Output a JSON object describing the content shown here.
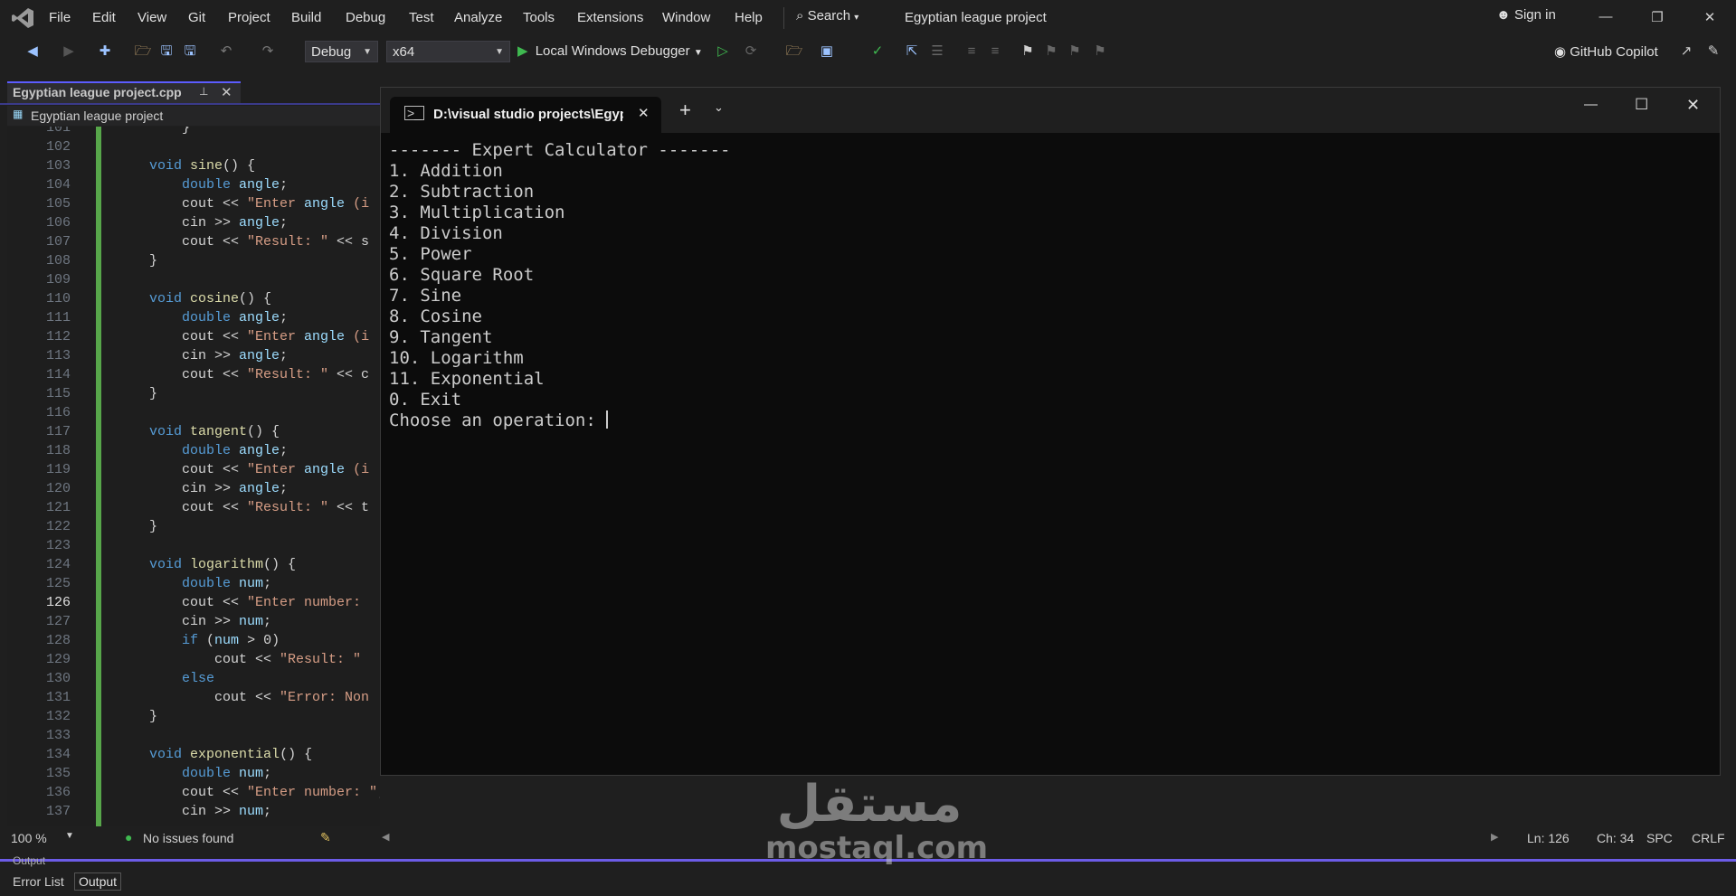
{
  "menu": {
    "items": [
      "File",
      "Edit",
      "View",
      "Git",
      "Project",
      "Build",
      "Debug",
      "Test",
      "Analyze",
      "Tools",
      "Extensions",
      "Window",
      "Help"
    ],
    "search_label": "Search",
    "solution_title": "Egyptian league project",
    "sign_in": "Sign in"
  },
  "toolbar": {
    "configuration": "Debug",
    "platform": "x64",
    "debugger_label": "Local Windows Debugger",
    "copilot_label": "GitHub Copilot"
  },
  "editor": {
    "tab_label": "Egyptian league project.cpp",
    "nav_project": "Egyptian league project",
    "lines": [
      {
        "num": "101",
        "text": "    }"
      },
      {
        "num": "102",
        "text": ""
      },
      {
        "num": "103",
        "text": "void sine() {"
      },
      {
        "num": "104",
        "text": "    double angle;"
      },
      {
        "num": "105",
        "text": "    cout << \"Enter angle (i"
      },
      {
        "num": "106",
        "text": "    cin >> angle;"
      },
      {
        "num": "107",
        "text": "    cout << \"Result: \" << s"
      },
      {
        "num": "108",
        "text": "}"
      },
      {
        "num": "109",
        "text": ""
      },
      {
        "num": "110",
        "text": "void cosine() {"
      },
      {
        "num": "111",
        "text": "    double angle;"
      },
      {
        "num": "112",
        "text": "    cout << \"Enter angle (i"
      },
      {
        "num": "113",
        "text": "    cin >> angle;"
      },
      {
        "num": "114",
        "text": "    cout << \"Result: \" << c"
      },
      {
        "num": "115",
        "text": "}"
      },
      {
        "num": "116",
        "text": ""
      },
      {
        "num": "117",
        "text": "void tangent() {"
      },
      {
        "num": "118",
        "text": "    double angle;"
      },
      {
        "num": "119",
        "text": "    cout << \"Enter angle (i"
      },
      {
        "num": "120",
        "text": "    cin >> angle;"
      },
      {
        "num": "121",
        "text": "    cout << \"Result: \" << t"
      },
      {
        "num": "122",
        "text": "}"
      },
      {
        "num": "123",
        "text": ""
      },
      {
        "num": "124",
        "text": "void logarithm() {"
      },
      {
        "num": "125",
        "text": "    double num;"
      },
      {
        "num": "126",
        "text": "    cout << \"Enter number: "
      },
      {
        "num": "127",
        "text": "    cin >> num;"
      },
      {
        "num": "128",
        "text": "    if (num > 0)"
      },
      {
        "num": "129",
        "text": "        cout << \"Result: \""
      },
      {
        "num": "130",
        "text": "    else"
      },
      {
        "num": "131",
        "text": "        cout << \"Error: Non"
      },
      {
        "num": "132",
        "text": "}"
      },
      {
        "num": "133",
        "text": ""
      },
      {
        "num": "134",
        "text": "void exponential() {"
      },
      {
        "num": "135",
        "text": "    double num;"
      },
      {
        "num": "136",
        "text": "    cout << \"Enter number: \";"
      },
      {
        "num": "137",
        "text": "    cin >> num;"
      }
    ]
  },
  "console": {
    "tab_title": "D:\\visual studio projects\\Egyp",
    "output": "------- Expert Calculator -------\n1. Addition\n2. Subtraction\n3. Multiplication\n4. Division\n5. Power\n6. Square Root\n7. Sine\n8. Cosine\n9. Tangent\n10. Logarithm\n11. Exponential\n0. Exit\nChoose an operation: "
  },
  "status": {
    "zoom": "100 %",
    "issues": "No issues found",
    "line": "Ln: 126",
    "col": "Ch: 34",
    "spc": "SPC",
    "eol": "CRLF"
  },
  "bottom_tabs": [
    "Error List",
    "Output"
  ],
  "bottom_panel_title": "Output",
  "watermark": {
    "arabic": "مستقل",
    "latin": "mostaql.com"
  }
}
